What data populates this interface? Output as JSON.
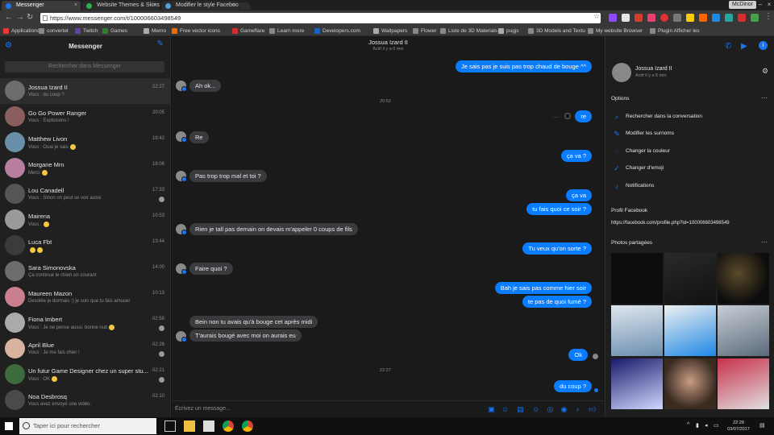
{
  "browser": {
    "tabs": [
      {
        "label": "Messenger",
        "color": "#1877f2",
        "active": true
      },
      {
        "label": "Website Themes & Skins",
        "color": "#2bb24c",
        "active": false
      },
      {
        "label": "Modifier le style Faceboo",
        "color": "#4aa3df",
        "active": false
      }
    ],
    "profile_label": "McDinor",
    "url": "https://www.messenger.com/t/100006603498549",
    "bookmarks": [
      {
        "label": "Applications",
        "color": "#e53935"
      },
      {
        "label": "convertet",
        "color": "#888"
      },
      {
        "label": "Twitch",
        "color": "#6441a5"
      },
      {
        "label": "Games",
        "color": "#2e7d32"
      },
      {
        "label": "Memo",
        "color": "#aaa"
      },
      {
        "label": "Free vector icons",
        "color": "#ef6c00"
      },
      {
        "label": "Gameflare",
        "color": "#d32f2f"
      },
      {
        "label": "Learn more",
        "color": "#888"
      },
      {
        "label": "Developers.com",
        "color": "#1565c0"
      },
      {
        "label": "Wallpapers",
        "color": "#aaa"
      },
      {
        "label": "Flower",
        "color": "#888"
      },
      {
        "label": "Liste de 3D Materials",
        "color": "#888"
      },
      {
        "label": "pugjs",
        "color": "#aaa"
      },
      {
        "label": "3D Models and Textu",
        "color": "#888"
      },
      {
        "label": "My website Browser",
        "color": "#888"
      },
      {
        "label": "Plugin Afficher les",
        "color": "#888"
      }
    ]
  },
  "sidebar": {
    "title": "Messenger",
    "search_placeholder": "Rechercher dans Messenger",
    "conversations": [
      {
        "name": "Jossua Izard II",
        "preview": "Vous : du coup ?",
        "time": "22:27",
        "color": "#6d6d6d"
      },
      {
        "name": "Go Go Power Ranger",
        "preview": "Vous : Explosions !",
        "time": "20:05",
        "color": "#8b5e5e"
      },
      {
        "name": "Matthew Livon",
        "preview": "Vous : Ouai je sais",
        "time": "18:42",
        "color": "#6a8fa8"
      },
      {
        "name": "Morgane Mrn",
        "preview": "Merci",
        "time": "18:06",
        "color": "#b87ea0"
      },
      {
        "name": "Lou Canadell",
        "preview": "Vous : Sinon on peut se voir aussi",
        "time": "17:33",
        "color": "#555"
      },
      {
        "name": "Mairena",
        "preview": "Vous :",
        "time": "10:53",
        "color": "#9a9a9a"
      },
      {
        "name": "Luca Fbt",
        "preview": "",
        "time": "13:44",
        "color": "#3b3b3b"
      },
      {
        "name": "Sara Simonovska",
        "preview": "Ça continue le chien on courant",
        "time": "14:00",
        "color": "#6d6d6d"
      },
      {
        "name": "Maureen Mazon",
        "preview": "Desolée je dormais :) je suis que tu fais amuser",
        "time": "10:13",
        "color": "#c97f8c"
      },
      {
        "name": "Fiona Imbert",
        "preview": "Vous : Je ne pense aussi, bonne nuit",
        "time": "02:58",
        "color": "#aaa"
      },
      {
        "name": "April Blue",
        "preview": "Vous : Je me fais chier !",
        "time": "02:26",
        "color": "#d8b4a0"
      },
      {
        "name": "Un futur Game Designer chez un super stu...",
        "preview": "Vous : OK",
        "time": "02:21",
        "color": "#3d6b3d"
      },
      {
        "name": "Noa Desbrosq",
        "preview": "Vous avez envoyé une vidéo.",
        "time": "02:10",
        "color": "#4a4a4a"
      }
    ]
  },
  "chat": {
    "contact_name": "Jossua Izard II",
    "contact_status": "Actif il y a 6 min",
    "messages": [
      {
        "text": "Je sais pas je suis pas trop chaud de bouge ^^",
        "dir": "out"
      },
      {
        "text": "Ah ok...",
        "dir": "in"
      },
      {
        "text": "20:52",
        "dir": "time"
      },
      {
        "text": "re",
        "dir": "out"
      },
      {
        "text": "Re",
        "dir": "in"
      },
      {
        "text": "ça va ?",
        "dir": "out"
      },
      {
        "text": "Pas trop trop mal et toi ?",
        "dir": "in"
      },
      {
        "text": "ça va",
        "dir": "out"
      },
      {
        "text": "tu fais quoi ce soir ?",
        "dir": "out"
      },
      {
        "text": "Rien je tall pas demain on devais m'appeler 0 coups de fils",
        "dir": "in"
      },
      {
        "text": "Tu veux qu'on sorte ?",
        "dir": "out"
      },
      {
        "text": "Faire quoi ?",
        "dir": "in"
      },
      {
        "text": "Bah je sais pas comme hier soir",
        "dir": "out"
      },
      {
        "text": "te pas de quoi fumé ?",
        "dir": "out"
      },
      {
        "text": "Bein non tu avais qu'à bouge cet après midi",
        "dir": "in"
      },
      {
        "text": "T'aurais bougé avec moi on aurais eu",
        "dir": "in"
      },
      {
        "text": "Ok",
        "dir": "out"
      },
      {
        "text": "22:27",
        "dir": "time"
      },
      {
        "text": "du coup ?",
        "dir": "out"
      }
    ],
    "composer_placeholder": "Écrivez un message..."
  },
  "details": {
    "contact_name": "Jossua Izard II",
    "contact_status": "Actif il y a 6 min",
    "options_title": "Options",
    "options": [
      {
        "label": "Rechercher dans la conversation",
        "icon": "search-icon"
      },
      {
        "label": "Modifier les surnoms",
        "icon": "pencil-icon"
      },
      {
        "label": "Changer la couleur",
        "icon": "palette-icon"
      },
      {
        "label": "Changer d'emoji",
        "icon": "thumbs-up-icon"
      },
      {
        "label": "Notifications",
        "icon": "bell-icon"
      }
    ],
    "profile_title": "Profil Facebook",
    "profile_url": "https://facebook.com/profile.php?id=100006603498549",
    "photos_title": "Photos partagées"
  },
  "taskbar": {
    "search_placeholder": "Taper ici pour rechercher",
    "time": "22:28",
    "date": "03/07/2017"
  }
}
